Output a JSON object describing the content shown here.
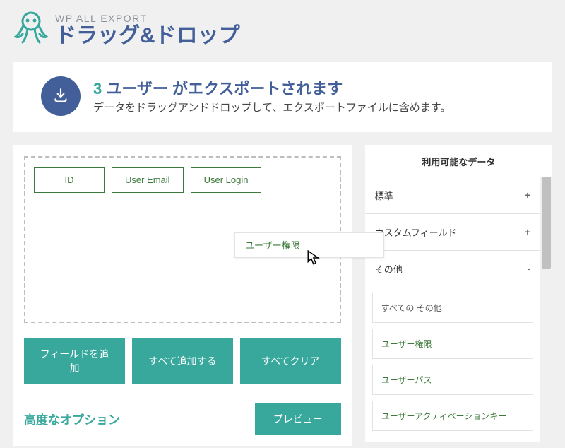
{
  "header": {
    "brand": "WP ALL EXPORT",
    "title": "ドラッグ&ドロップ"
  },
  "banner": {
    "count": "3",
    "title_rest": "ユーザー がエクスポートされます",
    "desc": "データをドラッグアンドドロップして、エクスポートファイルに含めます。"
  },
  "drop_zone": {
    "fields": [
      {
        "label": "ID"
      },
      {
        "label": "User Email"
      },
      {
        "label": "User Login"
      }
    ],
    "dragging": "ユーザー権限"
  },
  "buttons": {
    "add_field": "フィールドを追加",
    "add_all": "すべて追加する",
    "clear_all": "すべてクリア"
  },
  "footer": {
    "advanced": "高度なオプション",
    "preview": "プレビュー"
  },
  "sidebar": {
    "title": "利用可能なデータ",
    "groups": {
      "standard": {
        "label": "標準",
        "toggle": "+"
      },
      "custom": {
        "label": "カスタムフィールド",
        "toggle": "+"
      },
      "other": {
        "label": "その他",
        "toggle": "-",
        "items": [
          {
            "label": "すべての その他",
            "muted": true
          },
          {
            "label": "ユーザー権限"
          },
          {
            "label": "ユーザーパス"
          },
          {
            "label": "ユーザーアクティベーションキー"
          }
        ]
      }
    }
  }
}
